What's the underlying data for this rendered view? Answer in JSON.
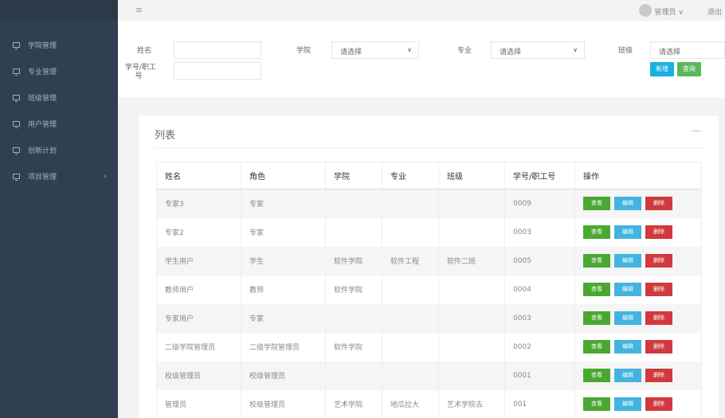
{
  "sidebar": {
    "items": [
      {
        "label": "学院管理",
        "icon": "monitor-icon"
      },
      {
        "label": "专业管理",
        "icon": "monitor-icon"
      },
      {
        "label": "班级管理",
        "icon": "monitor-icon"
      },
      {
        "label": "用户管理",
        "icon": "monitor-icon"
      },
      {
        "label": "创新计划",
        "icon": "monitor-icon"
      },
      {
        "label": "项目管理",
        "icon": "monitor-icon",
        "arrow": "›"
      }
    ]
  },
  "header": {
    "hamburger": "≡",
    "user": "管理员 ∨",
    "logout": "退出"
  },
  "filter": {
    "name_label": "姓名",
    "college_label": "学院",
    "college_select": "请选择",
    "major_label": "专业",
    "major_select": "请选择",
    "class_label": "班级",
    "class_select": "请选择",
    "id_label_1": "学号/职工",
    "id_label_2": "号",
    "add_button": "新增",
    "query_button": "查询",
    "caret": "∨"
  },
  "panel": {
    "title": "列表",
    "collapse": "—"
  },
  "table": {
    "headers": [
      "姓名",
      "角色",
      "学院",
      "专业",
      "班级",
      "学号/职工号",
      "操作"
    ],
    "rows": [
      [
        "专家3",
        "专家",
        "",
        "",
        "",
        "0009"
      ],
      [
        "专家2",
        "专家",
        "",
        "",
        "",
        "0003"
      ],
      [
        "学生用户",
        "学生",
        "软件学院",
        "软件工程",
        "软件二班",
        "0005"
      ],
      [
        "教师用户",
        "教师",
        "软件学院",
        "",
        "",
        "0004"
      ],
      [
        "专家用户",
        "专家",
        "",
        "",
        "",
        "0003"
      ],
      [
        "二级学院管理员",
        "二级学院管理员",
        "软件学院",
        "",
        "",
        "0002"
      ],
      [
        "校级管理员",
        "校级管理员",
        "",
        "",
        "",
        "0001"
      ],
      [
        "管理员",
        "校级管理员",
        "艺术学院",
        "地瓜拉大",
        "艺术学院去",
        "001"
      ]
    ],
    "actions": {
      "view": "查看",
      "edit": "编辑",
      "delete": "删除"
    }
  }
}
